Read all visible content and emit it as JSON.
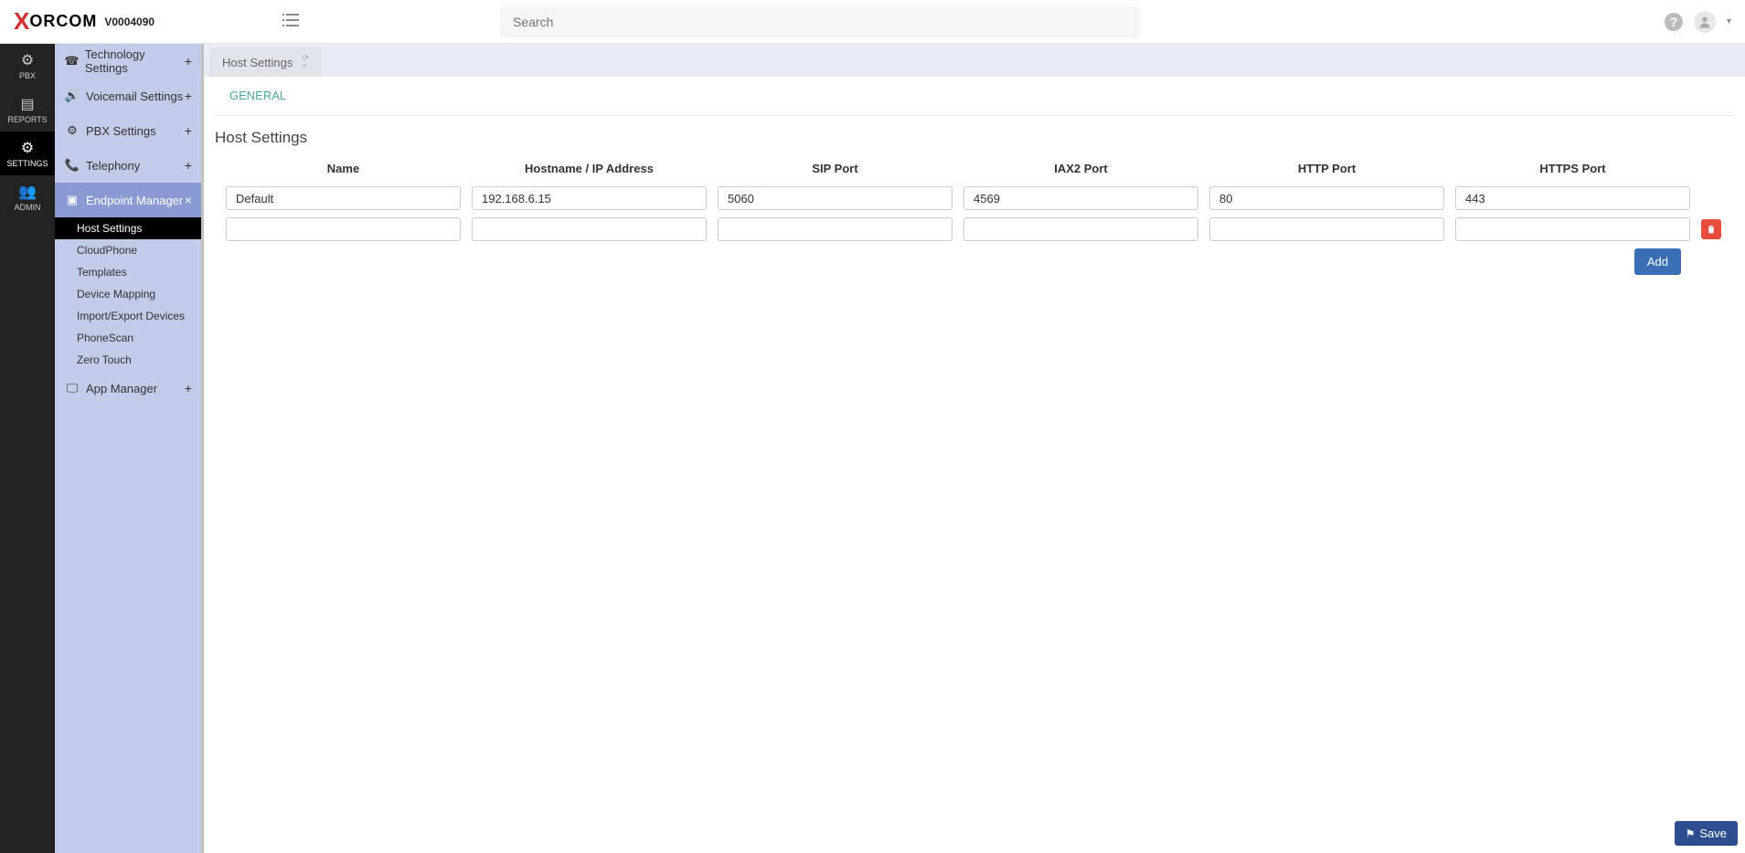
{
  "header": {
    "brand": "ORCOM",
    "version": "V0004090",
    "search_placeholder": "Search"
  },
  "navrail": [
    {
      "label": "PBX"
    },
    {
      "label": "REPORTS"
    },
    {
      "label": "SETTINGS"
    },
    {
      "label": "ADMIN"
    }
  ],
  "sidebar": {
    "items": [
      {
        "icon": "phone-classic",
        "label": "Technology Settings",
        "expand": "+"
      },
      {
        "icon": "volume",
        "label": "Voicemail Settings",
        "expand": "+"
      },
      {
        "icon": "gear",
        "label": "PBX Settings",
        "expand": "+"
      },
      {
        "icon": "handset",
        "label": "Telephony",
        "expand": "+"
      },
      {
        "icon": "phone-sq",
        "label": "Endpoint Manager",
        "expand": "×",
        "active": true
      },
      {
        "icon": "monitor",
        "label": "App Manager",
        "expand": "+"
      }
    ],
    "sub": [
      {
        "label": "Host Settings",
        "active": true
      },
      {
        "label": "CloudPhone"
      },
      {
        "label": "Templates"
      },
      {
        "label": "Device Mapping"
      },
      {
        "label": "Import/Export Devices"
      },
      {
        "label": "PhoneScan"
      },
      {
        "label": "Zero Touch"
      }
    ]
  },
  "tab_title": "Host Settings",
  "subtab": "GENERAL",
  "page_title": "Host Settings",
  "columns": [
    "Name",
    "Hostname / IP Address",
    "SIP Port",
    "IAX2 Port",
    "HTTP Port",
    "HTTPS Port"
  ],
  "rows": [
    {
      "name": "Default",
      "host": "192.168.6.15",
      "sip": "5060",
      "iax2": "4569",
      "http": "80",
      "https": "443"
    },
    {
      "name": "",
      "host": "",
      "sip": "",
      "iax2": "",
      "http": "",
      "https": ""
    }
  ],
  "add_label": "Add",
  "save_label": "Save"
}
